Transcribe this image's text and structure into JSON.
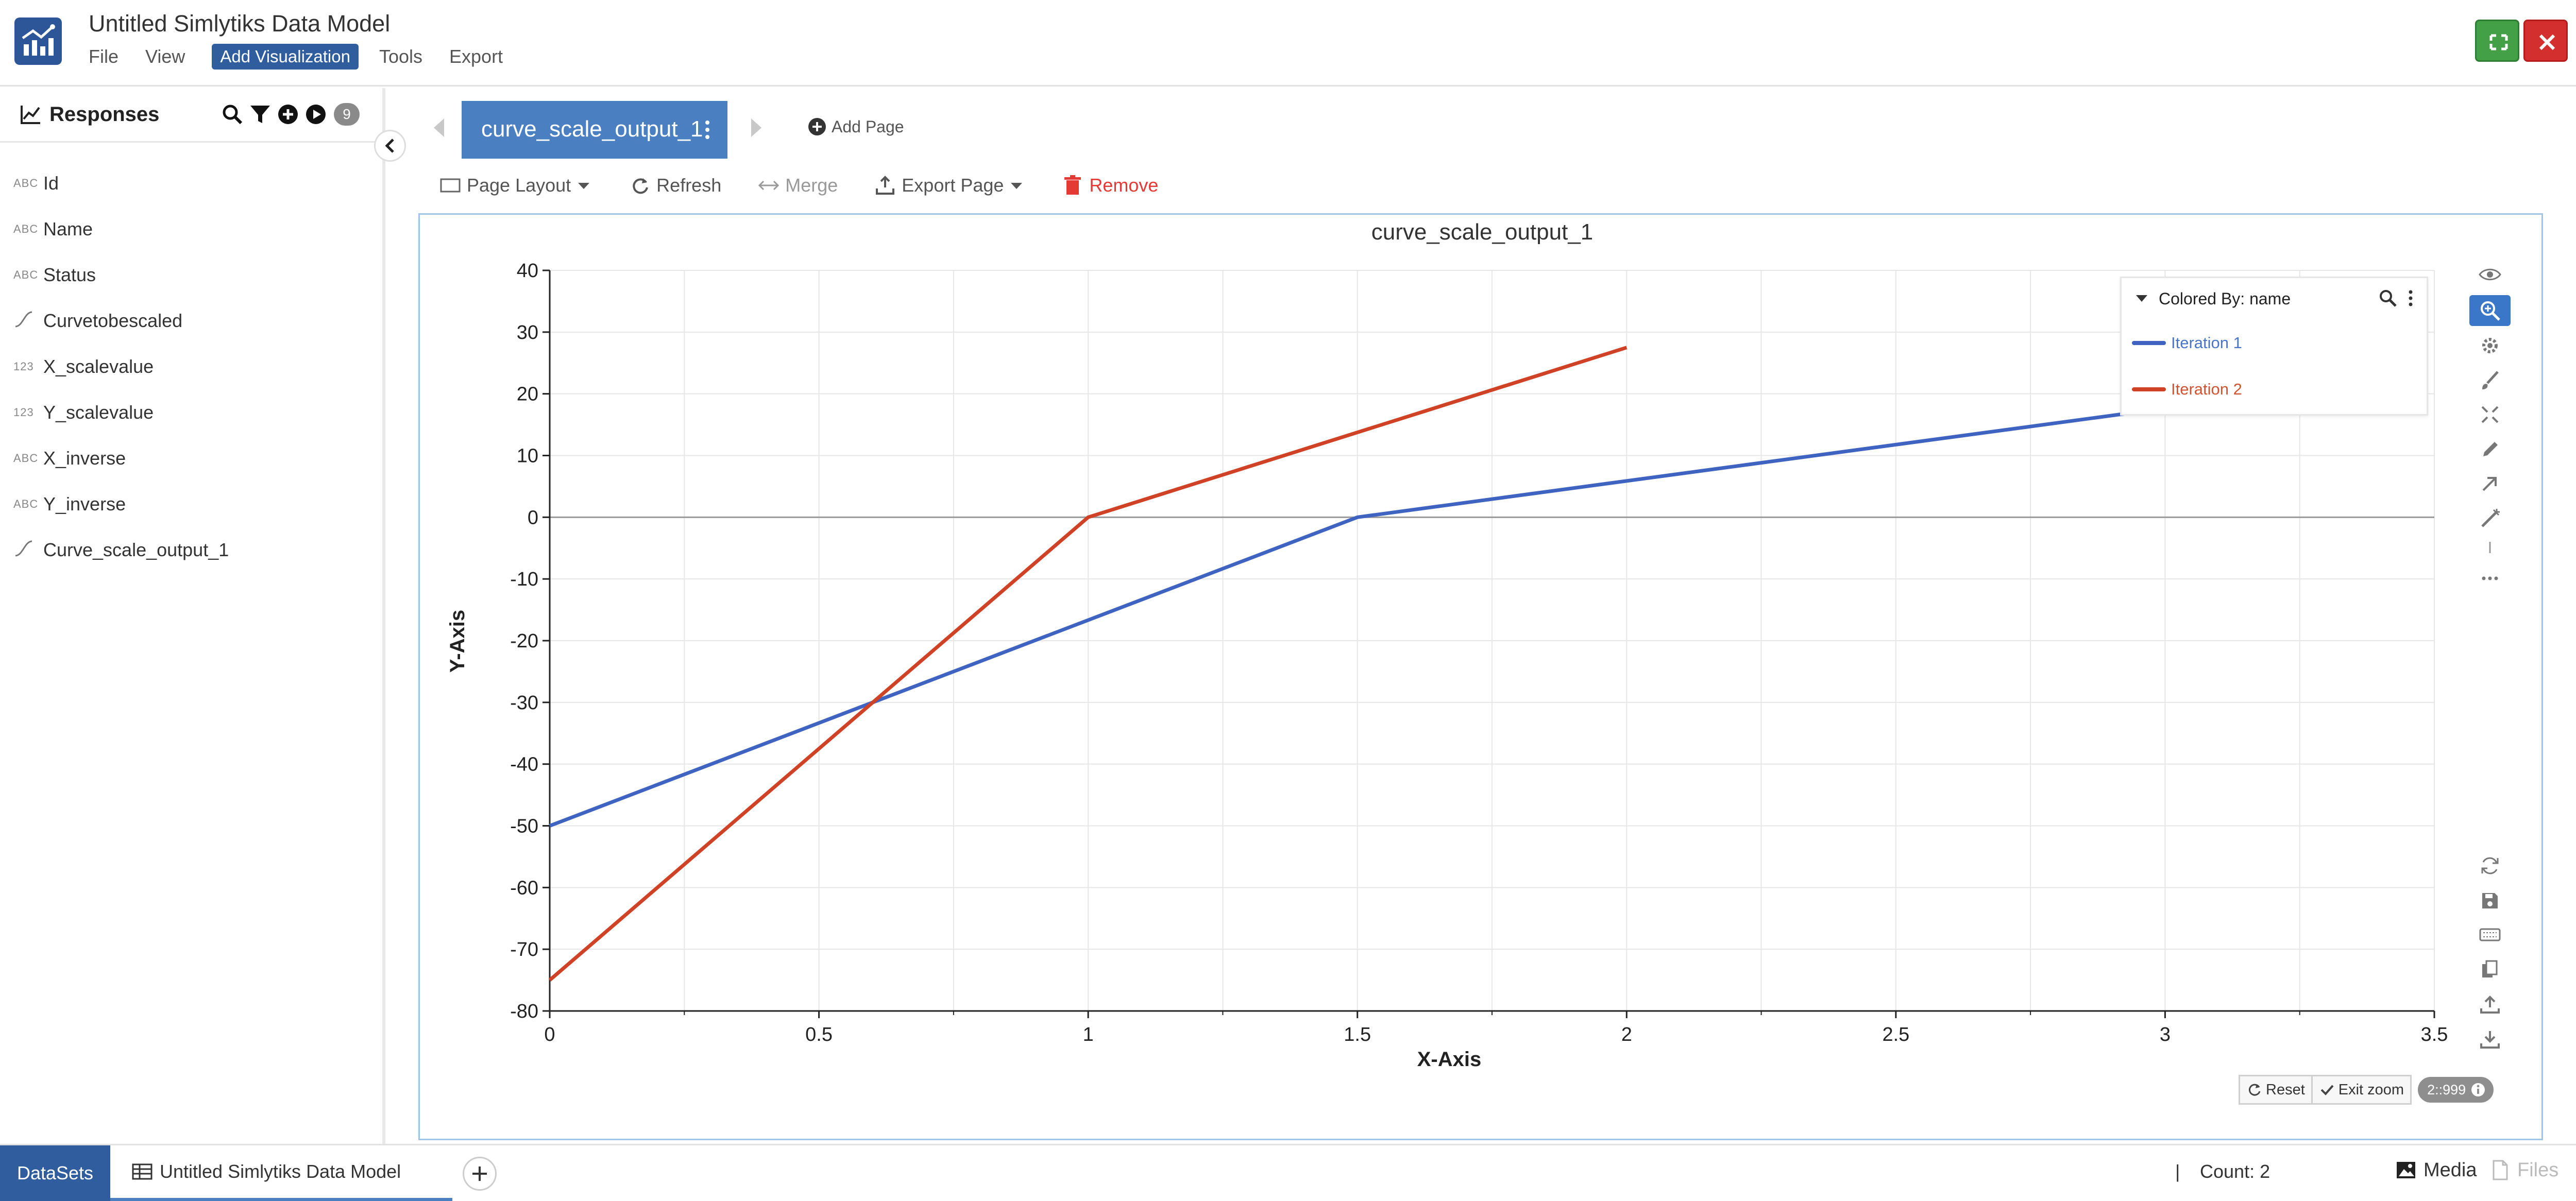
{
  "app": {
    "title": "Untitled Simlytiks Data Model",
    "menu": [
      "File",
      "View",
      "Add Visualization",
      "Tools",
      "Export"
    ],
    "active_menu": "Add Visualization"
  },
  "sidebar": {
    "title": "Responses",
    "count": "9",
    "fields": [
      {
        "type": "ABC",
        "icon": "text-type",
        "label": "Id"
      },
      {
        "type": "ABC",
        "icon": "text-type",
        "label": "Name"
      },
      {
        "type": "ABC",
        "icon": "text-type",
        "label": "Status"
      },
      {
        "type": "",
        "icon": "curve-type",
        "label": "Curvetobescaled"
      },
      {
        "type": "123",
        "icon": "number-type",
        "label": "X_scalevalue"
      },
      {
        "type": "123",
        "icon": "number-type",
        "label": "Y_scalevalue"
      },
      {
        "type": "ABC",
        "icon": "text-type",
        "label": "X_inverse"
      },
      {
        "type": "ABC",
        "icon": "text-type",
        "label": "Y_inverse"
      },
      {
        "type": "",
        "icon": "curve-type",
        "label": "Curve_scale_output_1"
      }
    ]
  },
  "pages": {
    "active_tab": "curve_scale_output_1",
    "add_page": "Add Page"
  },
  "toolbar": {
    "page_layout": "Page Layout",
    "refresh": "Refresh",
    "merge": "Merge",
    "export_page": "Export Page",
    "remove": "Remove"
  },
  "legend": {
    "title": "Colored By: name",
    "items": [
      "Iteration 1",
      "Iteration 2"
    ]
  },
  "zoom": {
    "reset": "Reset",
    "exit": "Exit zoom",
    "range": "2::999"
  },
  "footer": {
    "datasets": "DataSets",
    "model_tab": "Untitled Simlytiks Data Model",
    "separator": "|",
    "count": "Count: 2",
    "media": "Media",
    "files": "Files"
  },
  "colors": {
    "series_1": "#3f63c0",
    "series_2": "#cf4226",
    "accent": "#2f5d9e",
    "tab": "#4a7fc1",
    "danger": "#e53935"
  },
  "chart_data": {
    "type": "line",
    "title": "curve_scale_output_1",
    "xlabel": "X-Axis",
    "ylabel": "Y-Axis",
    "xlim": [
      0,
      3.5
    ],
    "ylim": [
      -80,
      40
    ],
    "xticks": [
      0,
      0.5,
      1,
      1.5,
      2,
      2.5,
      3,
      3.5
    ],
    "xtick_labels": [
      "0",
      "0.5",
      "1",
      "1.5",
      "2",
      "2.5",
      "3",
      "3.5"
    ],
    "yticks": [
      -80,
      -70,
      -60,
      -50,
      -40,
      -30,
      -20,
      -10,
      0,
      10,
      20,
      30,
      40
    ],
    "ytick_labels": [
      "-80",
      "-70",
      "-60",
      "-50",
      "-40",
      "-30",
      "-20",
      "-10",
      "0",
      "10",
      "20",
      "30",
      "40"
    ],
    "grid": true,
    "legend_position": "top-right",
    "series": [
      {
        "name": "Iteration 1",
        "color": "#3f63c0",
        "x": [
          0,
          1.5,
          3.2
        ],
        "y": [
          -50,
          0,
          20
        ]
      },
      {
        "name": "Iteration 2",
        "color": "#cf4226",
        "x": [
          0,
          1,
          2
        ],
        "y": [
          -75,
          0,
          27.5
        ]
      }
    ]
  }
}
